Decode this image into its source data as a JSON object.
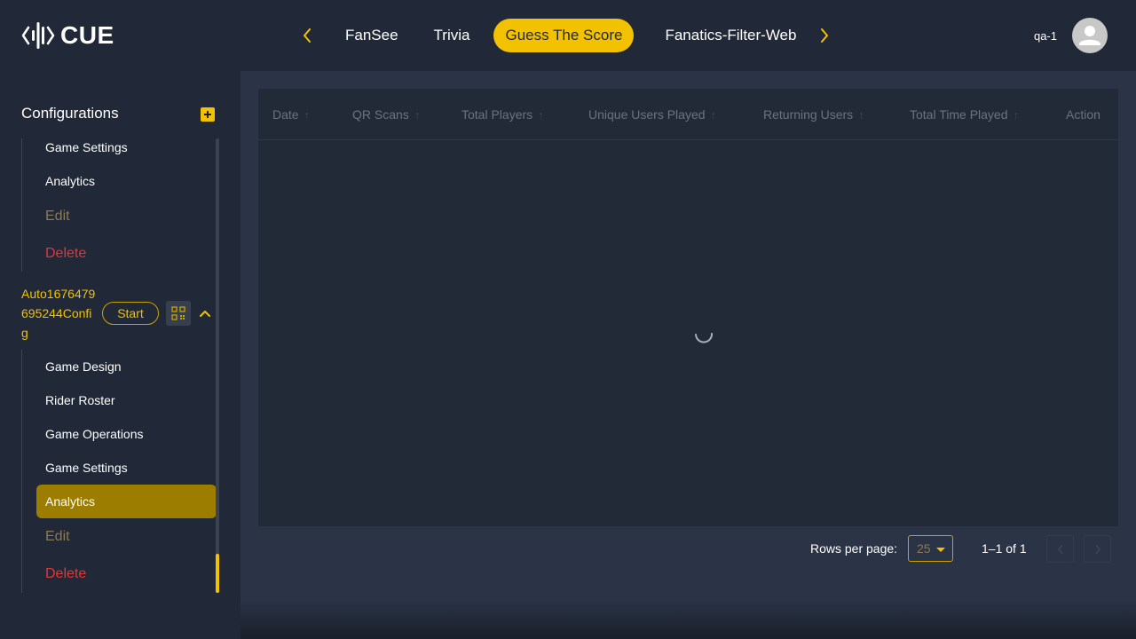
{
  "header": {
    "logo_text": "CUE",
    "tabs": [
      "FanSee",
      "Trivia",
      "Guess The Score",
      "Fanatics-Filter-Web"
    ],
    "active_tab": "Guess The Score",
    "username": "qa-1",
    "icons": {
      "prev": "chevron-left-icon",
      "next": "chevron-right-icon",
      "avatar": "user-avatar-icon"
    }
  },
  "sidebar": {
    "title": "Configurations",
    "prev_config_items": {
      "game_settings": "Game Settings",
      "analytics": "Analytics",
      "edit": "Edit",
      "delete": "Delete"
    },
    "config": {
      "name": "Auto1676479695244Config",
      "start_label": "Start",
      "items": {
        "game_design": "Game Design",
        "rider_roster": "Rider Roster",
        "game_operations": "Game Operations",
        "game_settings": "Game Settings",
        "analytics": "Analytics",
        "edit": "Edit",
        "delete": "Delete"
      },
      "active_item": "Analytics"
    },
    "colors": {
      "accent": "#f2c200",
      "delete": "#e0383a",
      "edit": "#8a7a55"
    }
  },
  "table": {
    "columns": [
      "Date",
      "QR Scans",
      "Total Players",
      "Unique Users Played",
      "Returning Users",
      "Total Time Played",
      "Action"
    ],
    "rows": [],
    "loading": true
  },
  "pagination": {
    "rows_per_page_label": "Rows per page:",
    "rows_per_page": "25",
    "range": "1–1 of 1"
  }
}
